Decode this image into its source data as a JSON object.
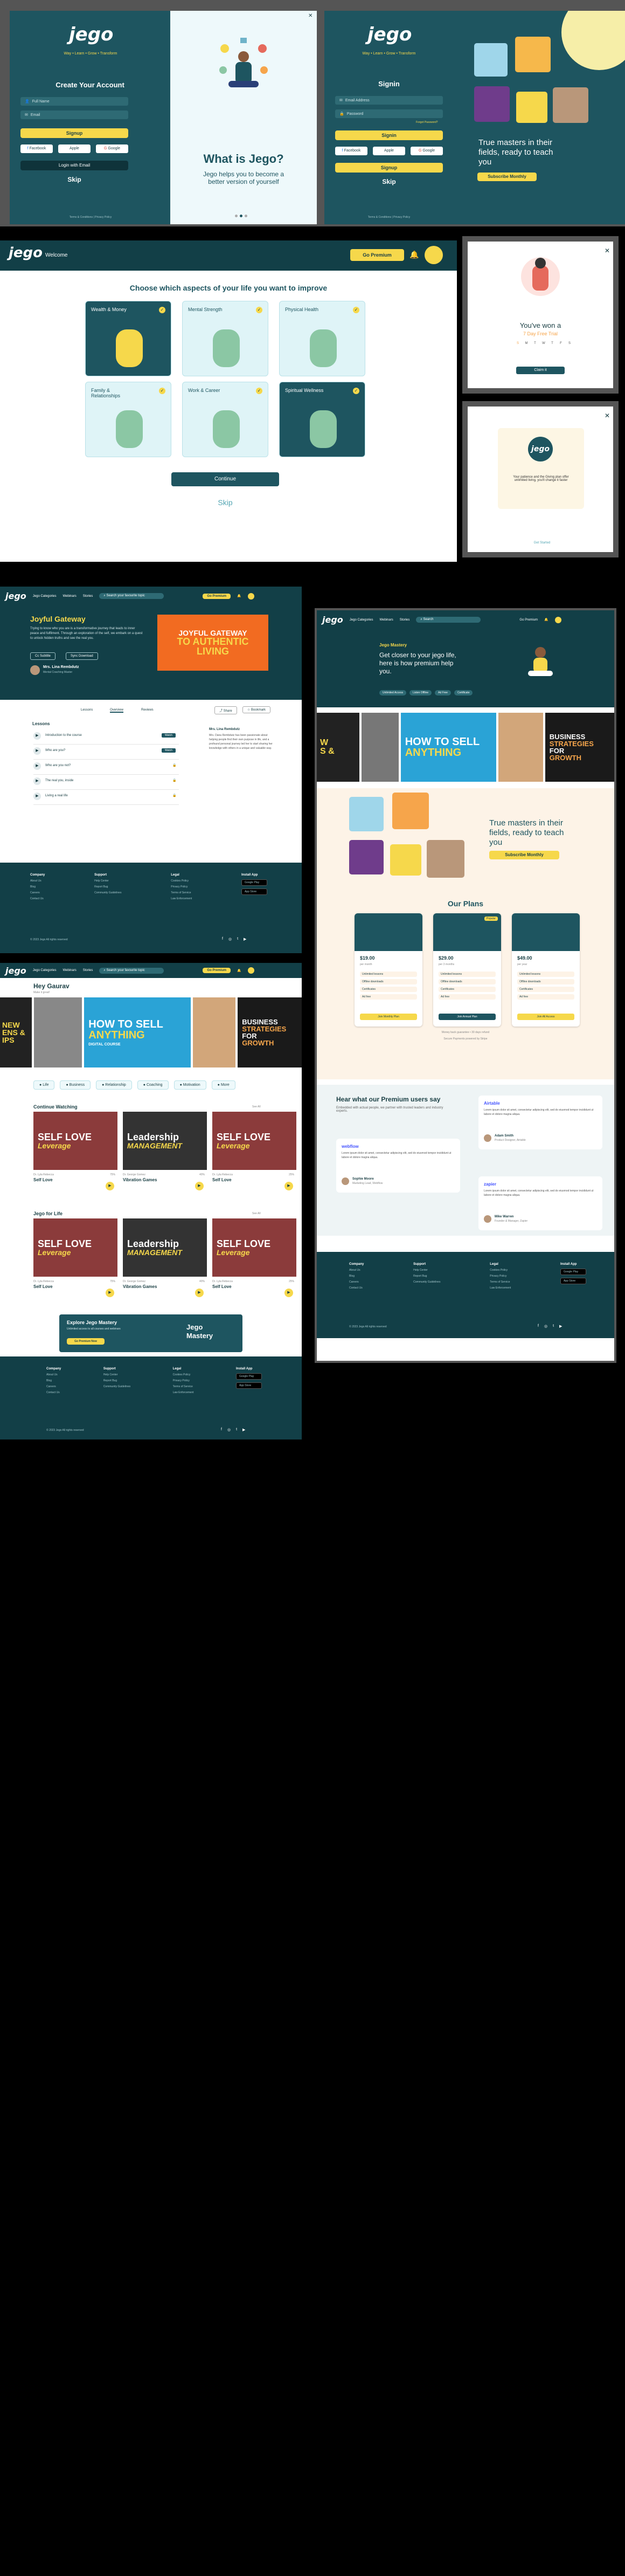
{
  "brand": {
    "logo_main": "jego",
    "logo_tagline": "Way • Learn • Grow • Transform"
  },
  "signup": {
    "title": "Create Your Account",
    "name_ph": "Full Name",
    "email_ph": "Email",
    "signup_btn": "Signup",
    "google": "Google",
    "apple": "Apple",
    "facebook": "Facebook",
    "alt_btn": "Login with Email",
    "skip": "Skip",
    "footer": "Terms & Conditions  |  Privacy Policy"
  },
  "whatis": {
    "title": "What is Jego?",
    "text": "Jego helps you to become a better version of yourself"
  },
  "signin": {
    "title": "Signin",
    "email_ph": "Email Address",
    "password_ph": "Password",
    "forgot": "Forgot Password?",
    "signin_btn": "Signin",
    "facebook": "Facebook",
    "apple": "Apple",
    "google": "Google",
    "signup_btn": "Signup",
    "skip": "Skip",
    "footer": "Terms & Conditions  |  Privacy Policy"
  },
  "masters": {
    "title": "True masters in their fields, ready to teach you",
    "btn": "Subscribe Monthly"
  },
  "onboard": {
    "nav": "Welcome",
    "premium": "Go Premium",
    "title": "Choose which aspects of your life you want to improve",
    "cards": [
      {
        "label": "Wealth & Money"
      },
      {
        "label": "Mental Strength"
      },
      {
        "label": "Physical Health"
      },
      {
        "label": "Family & Relationships"
      },
      {
        "label": "Work & Career"
      },
      {
        "label": "Spiritual Wellness"
      }
    ],
    "continue": "Continue",
    "skip": "Skip"
  },
  "modal_won": {
    "title": "You've won a",
    "sub": "7 Day Free Trial",
    "days": [
      "S",
      "M",
      "T",
      "W",
      "T",
      "F",
      "S"
    ],
    "btn": "Claim it"
  },
  "modal_welcome": {
    "text": "Your patience and the Giving plan offer unlimited living, you'll change it faster",
    "link": "Get Started"
  },
  "course": {
    "nav": [
      "Jego Categories",
      "Webinars",
      "Stories"
    ],
    "search_ph": "Search your favourite topic",
    "premium": "Go Premium",
    "title": "Joyful Gateway",
    "desc": "Trying to know who you are is a transformative journey that leads to inner peace and fulfilment. Through an exploration of the self, we embark on a quest to unlock hidden truths and see the real you.",
    "btns": [
      "Cc Subtitle",
      "Sync Download"
    ],
    "author": "Mrs. Lina Rembdutz",
    "author_sub": "Mental Coaching Master",
    "tabs": [
      "Lessons",
      "Overview",
      "Reviews"
    ],
    "poster_lines": [
      "JOYFUL GATEWAY",
      "TO AUTHENTIC",
      "LIVING"
    ],
    "lessons_title": "Lessons",
    "lessons": [
      "Introduction to the course",
      "Who are you?",
      "Who are you not?",
      "The real you, inside",
      "Living a real life"
    ],
    "lesson_btn": "Watch",
    "right_title": "Mrs. Lina Rembdutz",
    "right_text": "Mrs. Dana Rembdutz has been passionate about helping people find their own purpose in life, and a profound personal journey led her to start sharing her knowledge with others in a unique and valuable way.",
    "share": "Share",
    "bookmark": "Bookmark"
  },
  "footer": {
    "cols": [
      {
        "h": "Company",
        "items": [
          "About Us",
          "Blog",
          "Careers",
          "Contact Us"
        ]
      },
      {
        "h": "Support",
        "items": [
          "Help Center",
          "Report Bug",
          "Community Guidelines"
        ]
      },
      {
        "h": "Legal",
        "items": [
          "Cookies Policy",
          "Privacy Policy",
          "Terms of Service",
          "Law Enforcement"
        ]
      },
      {
        "h": "Install App",
        "items": [
          "Google Play",
          "App Store"
        ]
      }
    ],
    "copy": "© 2023 Jego All rights reserved"
  },
  "landing": {
    "nav": [
      "Jego Categories",
      "Webinars",
      "Stories"
    ],
    "search_ph": "Search",
    "premium": "Go Premium",
    "title": "Jego Mastery",
    "text": "Get closer to your jego life, here is how premium help you.",
    "chips": [
      "Unlimited Access",
      "Listen Offline",
      "Ad Free",
      "Certificate"
    ],
    "masters_title": "True masters in their fields, ready to teach you",
    "masters_btn": "Subscribe Monthly",
    "plans_title": "Our Plans",
    "plans": [
      {
        "price": "$19.00",
        "sub": "per month",
        "btn": "Join Monthly Plan"
      },
      {
        "price": "$29.00",
        "sub": "per 3 months",
        "badge": "Popular",
        "btn": "Join Annual Plan"
      },
      {
        "price": "$49.00",
        "sub": "per year",
        "btn": "Join All Access"
      }
    ],
    "plan_feats": [
      "Unlimited lessons",
      "Offline downloads",
      "Certificates",
      "Ad free"
    ],
    "refund": "Money back guarantee • 30 days refund",
    "note": "Secure Payments powered by Stripe",
    "reviews_title": "Hear what our Premium users say",
    "reviews_sub": "Embedded with actual people, we partner with trusted leaders and industry experts.",
    "reviews": [
      {
        "brand": "Airtable",
        "text": "Lorem ipsum dolor sit amet, consectetur adipiscing elit, sed do eiusmod tempor incididunt ut labore et dolore magna aliqua.",
        "name": "Adam Smith",
        "role": "Product Designer, Airtable"
      },
      {
        "brand": "webflow",
        "text": "Lorem ipsum dolor sit amet, consectetur adipiscing elit, sed do eiusmod tempor incididunt ut labore et dolore magna aliqua.",
        "name": "Sophie Moore",
        "role": "Marketing Lead, Webflow"
      },
      {
        "brand": "zapier",
        "text": "Lorem ipsum dolor sit amet, consectetur adipiscing elit, sed do eiusmod tempor incididunt ut labore et dolore magna aliqua.",
        "name": "Mike Warren",
        "role": "Founder & Manager, Zapier"
      }
    ]
  },
  "home": {
    "greeting": "Hey Gaurav",
    "sub": "Make it great!",
    "nav": [
      "Jego Categories",
      "Webinars",
      "Stories"
    ],
    "search_ph": "Search your favourite topic",
    "premium": "Go Premium",
    "banners": [
      {
        "lines": [
          "NEW",
          "ENS &",
          "IPS"
        ]
      },
      {
        "lines": [
          "HOW TO SELL",
          "ANYTHING"
        ],
        "sub": "DIGITAL COURSE"
      },
      {
        "lines": [
          "BUSINESS",
          "STRATEGIES",
          "FOR",
          "GROWTH"
        ]
      }
    ],
    "cats": [
      "Life",
      "Business",
      "Relationship",
      "Coaching",
      "Motivation",
      "More"
    ],
    "continue_title": "Continue Watching",
    "see_all": "See All",
    "jego_title": "Jego for Life",
    "items": [
      {
        "title": "Self Love",
        "poster": [
          "SELF LOVE",
          "Leverage"
        ],
        "author": "Dr. Lyla Rebecca",
        "pct": "75%"
      },
      {
        "title": "Vibration Games",
        "poster": [
          "Leadership",
          "MANAGEMENT"
        ],
        "author": "Dr. George Gomez",
        "pct": "40%"
      },
      {
        "title": "Self Love",
        "poster": [
          "SELF LOVE",
          "Leverage"
        ],
        "author": "Dr. Lyla Rebecca",
        "pct": "25%"
      }
    ],
    "mastery_title": "Explore Jego Mastery",
    "mastery_text": "Unlimited access to all courses and webinars",
    "mastery_btn": "Go Premium Now",
    "mastery_logo": "Jego Mastery"
  },
  "colors": {
    "teal": "#1e5560",
    "dark_teal": "#123f47",
    "yellow": "#f6d84b",
    "mint": "#dff4f7"
  }
}
